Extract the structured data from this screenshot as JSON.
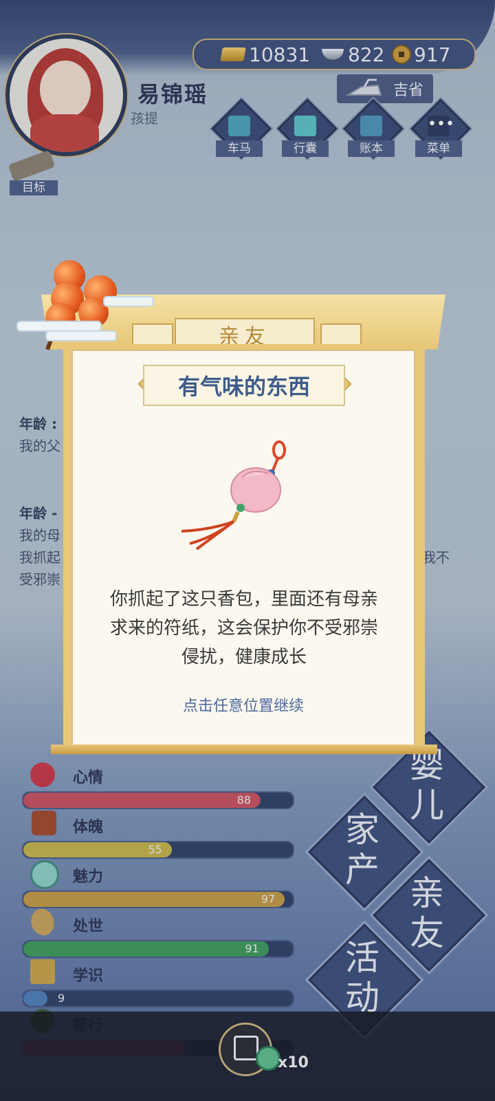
{
  "player": {
    "name": "易锦瑶",
    "stage": "孩提"
  },
  "currency": {
    "gold": "10831",
    "silver": "822",
    "coins": "917"
  },
  "region": "吉省",
  "menu": [
    {
      "label": "车马",
      "icon": "carriage-icon"
    },
    {
      "label": "行囊",
      "icon": "bag-icon"
    },
    {
      "label": "账本",
      "icon": "ledger-icon"
    },
    {
      "label": "菜单",
      "icon": "menu-dots-icon"
    }
  ],
  "goal_label": "目标",
  "background_log": {
    "entry1_head": "年龄 :",
    "entry1_text": "我的父",
    "entry2_head": "年龄 -",
    "entry2_line1": "我的母",
    "entry2_line2": "我抓起",
    "entry2_line2_right": "我不",
    "entry2_line3": "受邪崇"
  },
  "stats": [
    {
      "label": "心情",
      "value": 88,
      "fraction": 0.88,
      "color": "#c9515f",
      "icon": "flower-icon"
    },
    {
      "label": "体魄",
      "value": 55,
      "fraction": 0.55,
      "color": "#c4b34a",
      "icon": "lantern-icon"
    },
    {
      "label": "魅力",
      "value": 97,
      "fraction": 0.97,
      "color": "#c29a45",
      "icon": "mirror-icon"
    },
    {
      "label": "处世",
      "value": 91,
      "fraction": 0.91,
      "color": "#3f9a5a",
      "icon": "gourd-icon"
    },
    {
      "label": "学识",
      "value": 9,
      "fraction": 0.09,
      "color": "#4e7fb8",
      "icon": "books-icon"
    },
    {
      "label": "德行",
      "value": null,
      "fraction": 0.6,
      "color": "#7a3b52",
      "icon": "virtue-icon"
    }
  ],
  "big_buttons": {
    "baby": [
      "婴",
      "儿"
    ],
    "estate": [
      "家",
      "产"
    ],
    "relatives": [
      "亲",
      "友"
    ],
    "activity": [
      "活",
      "动"
    ]
  },
  "bottom": {
    "share_count": "x10"
  },
  "modal": {
    "header": "亲友",
    "title": "有气味的东西",
    "item_icon": "sachet-icon",
    "description_line1": "你抓起了这只香包，里面还有母亲",
    "description_line2": "求来的符纸，这会保护你不受邪崇",
    "description_line3": "侵扰，健康成长",
    "continue": "点击任意位置继续"
  }
}
